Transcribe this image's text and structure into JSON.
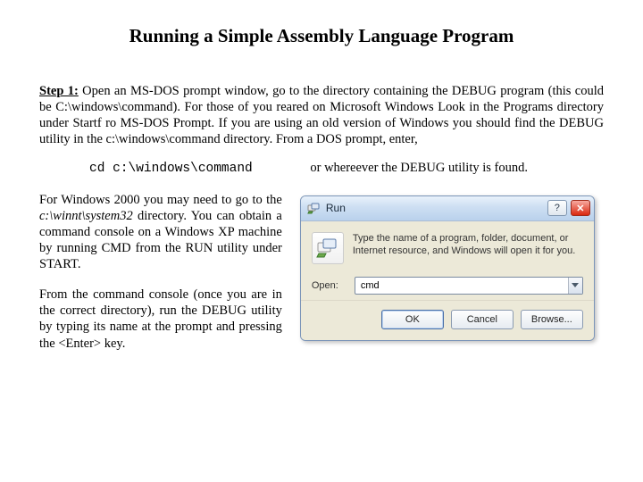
{
  "title": "Running a Simple Assembly Language Program",
  "step1": {
    "label": "Step 1:",
    "text": " Open an MS-DOS prompt window, go to the directory containing the DEBUG program (this could be C:\\windows\\command).  For those of you reared on Microsoft Windows Look in the Programs directory under Startf ro MS-DOS Prompt.  If you are using an old version of Windows you should find the DEBUG utility in the c:\\windows\\command directory.  From a DOS prompt, enter,"
  },
  "command": {
    "text": "cd c:\\windows\\command",
    "note": "or whereever the DEBUG utility is found."
  },
  "para2_a": "For Windows 2000 you may need to go to the ",
  "para2_italic": "c:\\winnt\\system32",
  "para2_b": " directory. You can obtain a command console on a Windows XP machine by running CMD from the RUN utility under START.",
  "para3": "From the command console (once you are in the correct directory), run the DEBUG utility by typing its name at the prompt and pressing the <Enter> key.",
  "runDialog": {
    "title": "Run",
    "description": "Type the name of a program, folder, document, or Internet resource, and Windows will open it for you.",
    "openLabel": "Open:",
    "openValue": "cmd",
    "buttons": {
      "ok": "OK",
      "cancel": "Cancel",
      "browse": "Browse..."
    }
  }
}
